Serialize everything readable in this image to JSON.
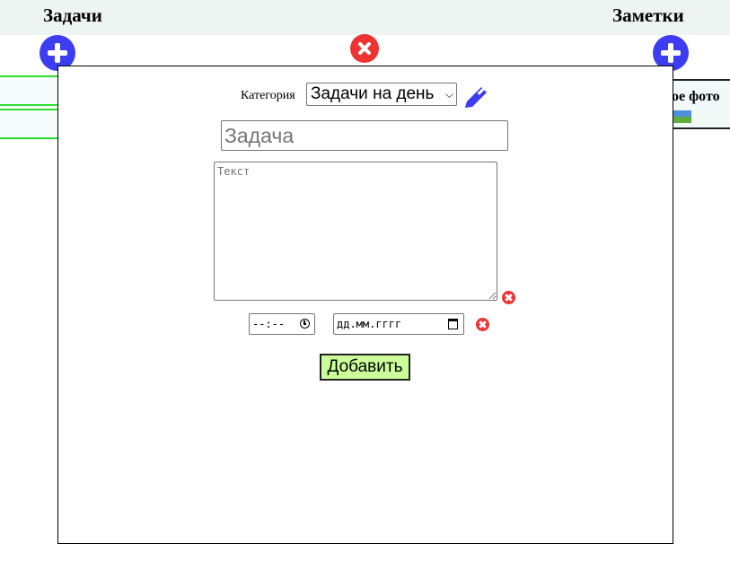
{
  "header": {
    "tasks_title": "Задачи",
    "notes_title": "Заметки"
  },
  "notes": {
    "card_title": "ое фото"
  },
  "modal": {
    "category_label": "Категория",
    "category_selected": "Задачи на день",
    "title_placeholder": "Задача",
    "text_placeholder": "Текст",
    "time_placeholder": "--:--",
    "date_placeholder": "дд.мм.гггг",
    "submit_label": "Добавить"
  },
  "colors": {
    "add_button": "#3c3cf0",
    "close_button": "#ee3333",
    "submit_bg": "#ccff99",
    "task_border": "#2ee02e"
  }
}
